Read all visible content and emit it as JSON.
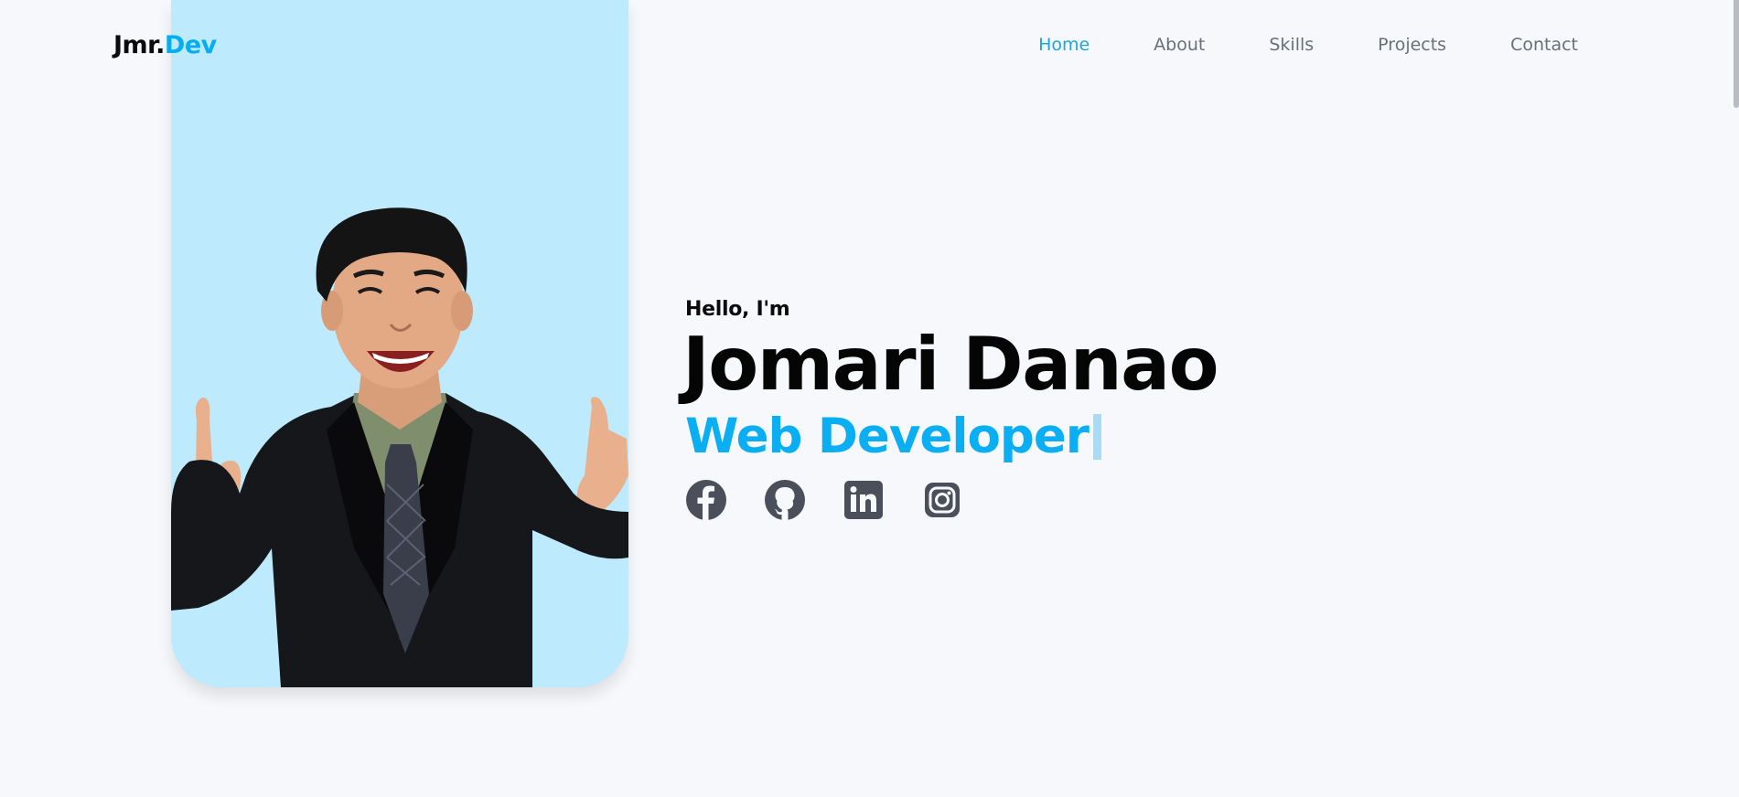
{
  "brand": {
    "prefix": "Jmr.",
    "accent": "Dev"
  },
  "nav": {
    "items": [
      {
        "label": "Home",
        "active": true
      },
      {
        "label": "About",
        "active": false
      },
      {
        "label": "Skills",
        "active": false
      },
      {
        "label": "Projects",
        "active": false
      },
      {
        "label": "Contact",
        "active": false
      }
    ]
  },
  "hero": {
    "greeting": "Hello, I'm",
    "name": "Jomari Danao",
    "role": "Web Developer",
    "socials": [
      {
        "icon": "facebook-icon"
      },
      {
        "icon": "github-icon"
      },
      {
        "icon": "linkedin-icon"
      },
      {
        "icon": "instagram-icon"
      }
    ]
  },
  "colors": {
    "accent": "#0aaef2",
    "card_bg": "#bdeafd",
    "page_bg": "#f6f8fc",
    "icon": "#4a4f5a"
  }
}
